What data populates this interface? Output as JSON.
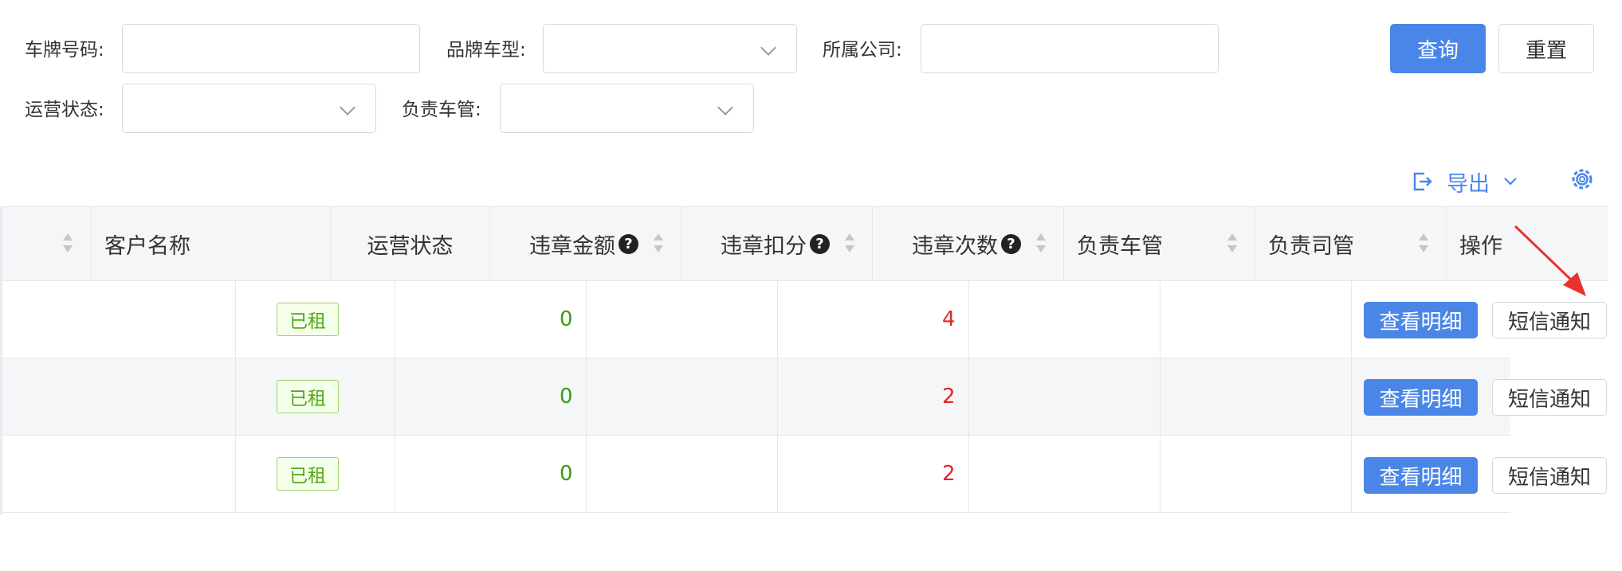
{
  "filters": {
    "plate_label": "车牌号码:",
    "plate_value": "",
    "brand_label": "品牌车型:",
    "brand_value": "",
    "company_label": "所属公司:",
    "company_value": "",
    "status_label": "运营状态:",
    "status_value": "",
    "manager_label": "负责车管:",
    "manager_value": ""
  },
  "actions": {
    "query": "查询",
    "reset": "重置",
    "export": "导出"
  },
  "table": {
    "columns": [
      "客户名称",
      "运营状态",
      "违章金额",
      "违章扣分",
      "违章次数",
      "负责车管",
      "负责司管",
      "操作"
    ],
    "rows": [
      {
        "status": "已租",
        "amount": "0",
        "count": "4",
        "detail": "查看明细",
        "sms": "短信通知"
      },
      {
        "status": "已租",
        "amount": "0",
        "count": "2",
        "detail": "查看明细",
        "sms": "短信通知"
      },
      {
        "status": "已租",
        "amount": "0",
        "count": "2",
        "detail": "查看明细",
        "sms": "短信通知"
      }
    ]
  },
  "colors": {
    "primary": "#4a86e8",
    "tag_green": "#52a81c",
    "amount_green": "#389e0d",
    "count_red": "#e3242b",
    "annotation_arrow": "#e8322d"
  },
  "icons": [
    "chevron-down-icon",
    "sort-icon",
    "question-icon",
    "export-icon",
    "gear-icon",
    "annotation-arrow-icon"
  ]
}
